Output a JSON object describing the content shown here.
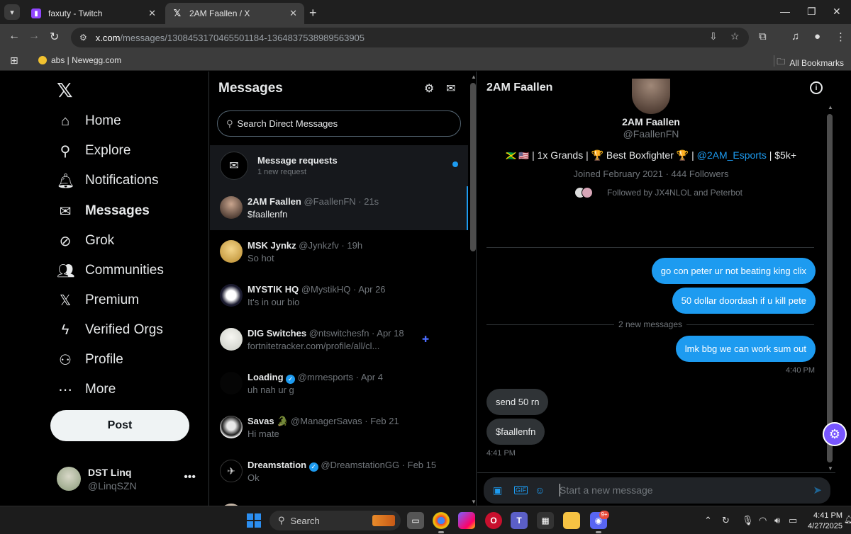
{
  "browser": {
    "tabs": [
      {
        "title": "faxuty - Twitch",
        "favicon": "twitch-icon"
      },
      {
        "title": "2AM Faallen / X",
        "favicon": "x-icon"
      }
    ],
    "url_host": "x.com",
    "url_path": "/messages/1308453170465501184-1364837538989563905",
    "bookmarks": [
      {
        "label": "abs | Newegg.com"
      }
    ],
    "all_bookmarks_label": "All Bookmarks"
  },
  "nav": {
    "items": [
      {
        "label": "Home",
        "icon": "home-icon"
      },
      {
        "label": "Explore",
        "icon": "search-icon"
      },
      {
        "label": "Notifications",
        "icon": "bell-icon"
      },
      {
        "label": "Messages",
        "icon": "envelope-icon"
      },
      {
        "label": "Grok",
        "icon": "grok-icon"
      },
      {
        "label": "Communities",
        "icon": "people-icon"
      },
      {
        "label": "Premium",
        "icon": "x-icon"
      },
      {
        "label": "Verified Orgs",
        "icon": "lightning-icon"
      },
      {
        "label": "Profile",
        "icon": "person-icon"
      },
      {
        "label": "More",
        "icon": "more-circle-icon"
      }
    ],
    "active": "Messages",
    "post_label": "Post",
    "account": {
      "name": "DST Linq",
      "handle": "@LinqSZN"
    }
  },
  "messages": {
    "title": "Messages",
    "search_placeholder": "Search Direct Messages",
    "requests": {
      "title": "Message requests",
      "subtitle": "1 new request"
    },
    "conversations": [
      {
        "name": "2AM Faallen",
        "handle": "@FaallenFN",
        "time": "21s",
        "preview": "$faallenfn",
        "selected": true
      },
      {
        "name": "MSK Jynkz",
        "handle": "@Jynkzfv",
        "time": "19h",
        "preview": "So hot"
      },
      {
        "name": "MYSTIK HQ",
        "handle": "@MystikHQ",
        "time": "Apr 26",
        "preview": "It's in our bio"
      },
      {
        "name": "DIG Switches",
        "handle": "@ntswitchesfn",
        "time": "Apr 18",
        "preview": "fortnitetracker.com/profile/all/cl..."
      },
      {
        "name": "Loading",
        "handle": "@mrnesports",
        "time": "Apr 4",
        "preview": "uh nah ur g",
        "verified": true
      },
      {
        "name": "Savas",
        "name_emoji": "🐊",
        "handle": "@ManagerSavas",
        "time": "Feb 21",
        "preview": "Hi mate"
      },
      {
        "name": "Dreamstation",
        "handle": "@DreamstationGG",
        "time": "Feb 15",
        "preview": "Ok",
        "verified": true
      }
    ]
  },
  "conversation": {
    "title": "2AM Faallen",
    "profile": {
      "name": "2AM Faallen",
      "handle": "@FaallenFN",
      "bio_flags": "🇯🇲 🇺🇸",
      "bio_part1": " | 1x Grands | 🏆 Best Boxfighter 🏆 | ",
      "bio_link": "@2AM_Esports",
      "bio_part2": " | $5k+",
      "joined": "Joined February 2021 · 444 Followers",
      "followed_by": "Followed by JX4NLOL and Peterbot"
    },
    "messages": [
      {
        "text": "go con peter ur not beating king clix",
        "dir": "out"
      },
      {
        "text": "50 dollar doordash if u kill pete",
        "dir": "out"
      },
      {
        "text": "lmk bbg we can work sum out",
        "dir": "out",
        "time": "4:40 PM"
      },
      {
        "text": "send 50 rn",
        "dir": "in"
      },
      {
        "text": "$faallenfn",
        "dir": "in",
        "time": "4:41 PM"
      }
    ],
    "divider_label": "2 new messages",
    "composer_placeholder": "Start a new message"
  },
  "taskbar": {
    "search_label": "Search",
    "time": "4:41 PM",
    "date": "4/27/2025",
    "discord_badge": "9+"
  },
  "colors": {
    "accent": "#1d9bf0",
    "background": "#000000",
    "bubble_in": "#2f3336",
    "muted_text": "#71767b",
    "grok_gear": "#7856ff"
  }
}
